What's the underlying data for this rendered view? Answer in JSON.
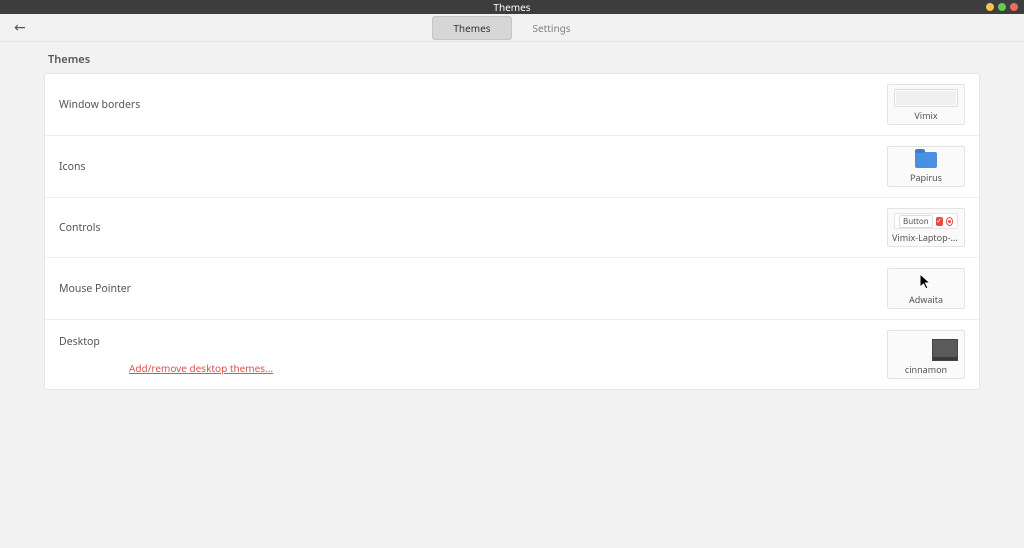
{
  "window": {
    "title": "Themes"
  },
  "tabs": {
    "themes": "Themes",
    "settings": "Settings"
  },
  "section": {
    "heading": "Themes"
  },
  "rows": {
    "window_borders": {
      "label": "Window borders",
      "value": "Vimix"
    },
    "icons": {
      "label": "Icons",
      "value": "Papirus"
    },
    "controls": {
      "label": "Controls",
      "value": "Vimix-Laptop-Ruby",
      "sample_button": "Button"
    },
    "mouse_pointer": {
      "label": "Mouse Pointer",
      "value": "Adwaita"
    },
    "desktop": {
      "label": "Desktop",
      "value": "cinnamon",
      "link": "Add/remove desktop themes..."
    }
  }
}
